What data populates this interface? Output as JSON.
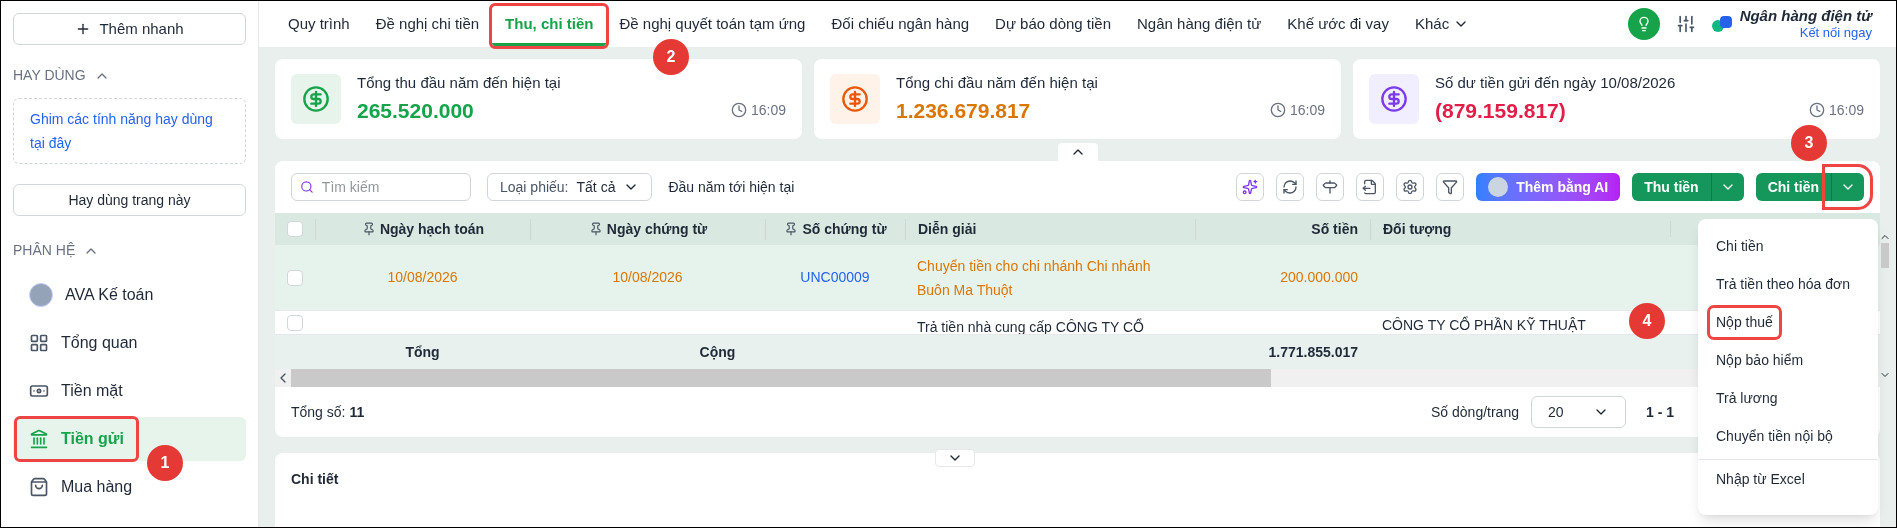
{
  "sidebar": {
    "quick_add": "Thêm nhanh",
    "favorites_header": {
      "label": "HAY DÙNG",
      "expanded": true
    },
    "favorites_hint": "Ghim các tính năng hay dùng tại đây",
    "favorite_page_button": "Hay dùng trang này",
    "modules_header": {
      "label": "PHÂN HỆ",
      "expanded": true
    },
    "items": [
      {
        "kind": "avatar",
        "label": "AVA Kế toán",
        "selected": false,
        "highlighted": false
      },
      {
        "kind": "dashboard",
        "label": "Tổng quan",
        "selected": false,
        "highlighted": false
      },
      {
        "kind": "cash",
        "label": "Tiền mặt",
        "selected": false,
        "highlighted": false
      },
      {
        "kind": "bank",
        "label": "Tiền gửi",
        "selected": true,
        "highlighted": true
      },
      {
        "kind": "bag",
        "label": "Mua hàng",
        "selected": false,
        "highlighted": false
      }
    ]
  },
  "tabs": [
    {
      "label": "Quy trình",
      "selected": false,
      "highlighted": false
    },
    {
      "label": "Đề nghị chi tiền",
      "selected": false,
      "highlighted": false
    },
    {
      "label": "Thu, chi tiền",
      "selected": true,
      "highlighted": true
    },
    {
      "label": "Đề nghị quyết toán tạm ứng",
      "selected": false,
      "highlighted": false
    },
    {
      "label": "Đối chiếu ngân hàng",
      "selected": false,
      "highlighted": false
    },
    {
      "label": "Dự báo dòng tiền",
      "selected": false,
      "highlighted": false
    },
    {
      "label": "Ngân hàng điện tử",
      "selected": false,
      "highlighted": false
    },
    {
      "label": "Khế ước đi vay",
      "selected": false,
      "highlighted": false
    },
    {
      "label": "Khác",
      "selected": false,
      "highlighted": false
    }
  ],
  "header_right": {
    "title": "Ngân hàng điện tử",
    "link": "Kết nối ngay"
  },
  "summary_cards": [
    {
      "kind": "income",
      "title": "Tổng thu đầu năm đến hiện tại",
      "value": "265.520.000",
      "time": "16:09"
    },
    {
      "kind": "expense",
      "title": "Tổng chi đầu năm đến hiện tại",
      "value": "1.236.679.817",
      "time": "16:09"
    },
    {
      "kind": "balance",
      "title": "Số dư tiền gửi đến ngày 10/08/2026",
      "value": "(879.159.817)",
      "time": "16:09"
    }
  ],
  "toolbar": {
    "search_placeholder": "Tìm kiếm",
    "type_filter_label": "Loại phiếu:",
    "type_filter_value": "Tất cả",
    "period": "Đầu năm tới hiện tại",
    "ai_button": "Thêm bằng AI",
    "receive_button": "Thu tiền",
    "pay_button": "Chi tiền",
    "pay_menu_button_highlighted": true
  },
  "table": {
    "all_selected": false,
    "columns": [
      "Ngày hạch toán",
      "Ngày chứng từ",
      "Số chứng từ",
      "Diễn giải",
      "Số tiền",
      "Đối tượng"
    ],
    "rows": [
      {
        "selected": false,
        "highlighted": true,
        "posting_date": "10/08/2026",
        "doc_date": "10/08/2026",
        "doc_no": "UNC00009",
        "description": "Chuyển tiền cho chi nhánh Chi nhánh Buôn Ma Thuột",
        "amount": "200.000.000",
        "party": ""
      },
      {
        "selected": false,
        "highlighted": false,
        "posting_date": "",
        "doc_date": "",
        "doc_no": "",
        "description": "Trả tiền nhà cung cấp CÔNG TY CỔ",
        "amount": "",
        "party": "CÔNG TY CỔ PHẦN KỸ THUẬT"
      }
    ],
    "footer": {
      "label": "Tổng",
      "label_2": "Cộng",
      "amount": "1.771.855.017"
    }
  },
  "pagination": {
    "total_label": "Tổng số:",
    "total": "11",
    "page_size_label": "Số dòng/trang",
    "page_size": "20",
    "range": "1 - 1"
  },
  "detail_panel": {
    "title": "Chi tiết"
  },
  "pay_menu": {
    "items": [
      {
        "label": "Chi tiền",
        "highlighted": false
      },
      {
        "label": "Trả tiền theo hóa đơn",
        "highlighted": false
      },
      {
        "label": "Nộp thuế",
        "highlighted": true
      },
      {
        "label": "Nộp bảo hiểm",
        "highlighted": false
      },
      {
        "label": "Trả lương",
        "highlighted": false
      },
      {
        "label": "Chuyển tiền nội bộ",
        "highlighted": false
      }
    ],
    "footer_item": "Nhập từ Excel"
  },
  "annotations": [
    "1",
    "2",
    "3",
    "4"
  ]
}
